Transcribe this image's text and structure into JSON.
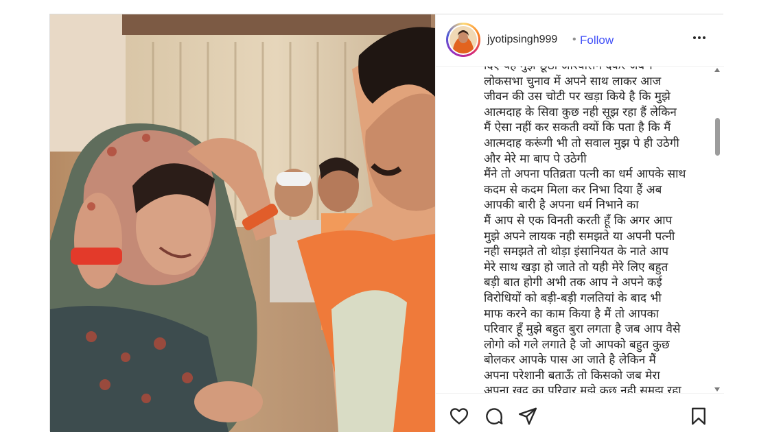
{
  "post": {
    "username": "jyotipsingh999",
    "separator": "•",
    "follow_label": "Follow",
    "more_icon": "more-horizontal-icon",
    "caption_lines": [
      "दिए यह मुझ छूठा आश्वासन देकर जब ।",
      "लोकसभा चुनाव में अपने साथ लाकर आज",
      "जीवन की उस चोटी पर खड़ा किये है कि मुझे",
      "आत्मदाह के सिवा कुछ नही सूझ रहा हैं लेकिन",
      "मैं ऐसा नहीं कर सकती क्यों कि पता है कि मैं",
      "आत्मदाह करूंगी भी तो सवाल मुझ पे ही उठेगी",
      "और मेरे मा बाप पे उठेगी",
      "मैंने तो अपना पतिव्रता पत्नी का धर्म आपके साथ",
      "कदम से कदम मिला कर निभा दिया हैं अब",
      "आपकी बारी है अपना धर्म निभाने का",
      "मैं आप से एक विनती करती हूँ कि अगर आप",
      "मुझे अपने लायक नही समझते या अपनी पत्नी",
      "नही समझते तो थोड़ा इंसानियत के नाते आप",
      "मेरे साथ खड़ा हो जाते तो यही मेरे लिए बहुत",
      "बड़ी बात होगी अभी तक आप ने अपने कई",
      "विरोधियों को बड़ी-बड़ी गलतियां के बाद भी",
      "माफ करने का काम किया है मैं तो आपका",
      "परिवार हूँ मुझे बहुत बुरा लगता है जब आप वैसे",
      "लोगो को गले लगाते है जो आपको बहुत कुछ",
      "बोलकर आपके पास आ जाते है लेकिन मैं",
      "अपना परेशानी बताऊँ तो किसको जब मेरा",
      "अपना खुद का परिवार मुझे कुछ नही समझ रहा"
    ]
  },
  "actions": {
    "like_icon": "heart-icon",
    "comment_icon": "comment-icon",
    "share_icon": "send-icon",
    "save_icon": "bookmark-icon"
  },
  "colors": {
    "follow": "#4150f7",
    "border": "#dbdbdb",
    "text": "#262626"
  }
}
